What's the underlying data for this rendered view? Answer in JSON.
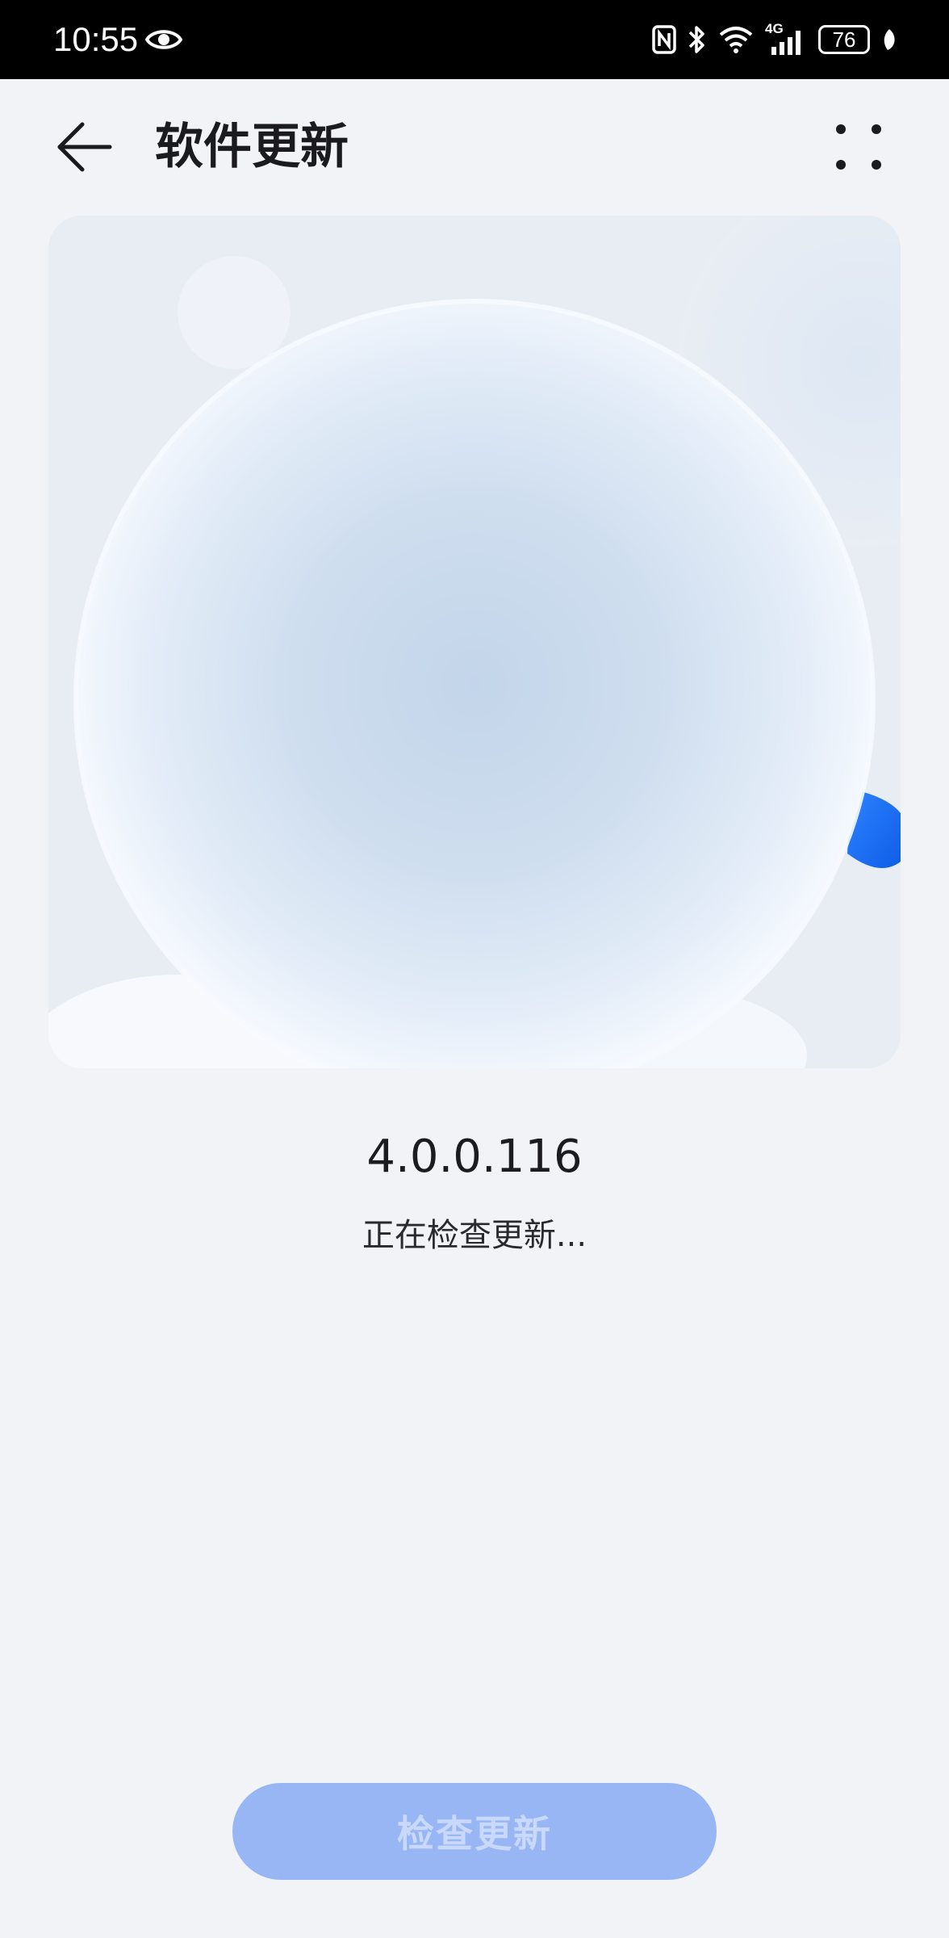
{
  "status_bar": {
    "time": "10:55",
    "network": "4G",
    "battery": "76",
    "icons": [
      "eye-icon",
      "nfc-icon",
      "bluetooth-icon",
      "wifi-icon",
      "cellular-signal-icon",
      "battery-icon",
      "leaf-icon"
    ]
  },
  "app_bar": {
    "title": "软件更新",
    "back_icon": "back-arrow-icon",
    "more_icon": "more-options-icon"
  },
  "main": {
    "version": "4.0.0.116",
    "status": "正在检查更新..."
  },
  "footer": {
    "check_button_label": "检查更新"
  },
  "colors": {
    "status_bar_bg": "#000000",
    "page_bg": "#f1f3f6",
    "button_bg": "#98b6f4",
    "button_text": "#c9d9fb",
    "accent_blue": "#1a6ef2"
  }
}
